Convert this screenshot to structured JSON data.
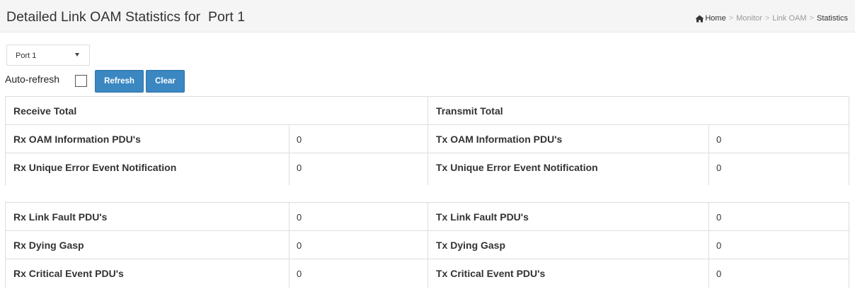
{
  "header": {
    "title": "Detailed Link OAM Statistics for  Port 1",
    "breadcrumb": [
      "Home",
      "Monitor",
      "Link OAM",
      "Statistics"
    ],
    "breadcrumb_separator": ">"
  },
  "controls": {
    "port_select": {
      "selected": "Port 1"
    },
    "auto_refresh_label": "Auto-refresh",
    "auto_refresh_checked": false,
    "refresh_label": "Refresh",
    "clear_label": "Clear"
  },
  "table": {
    "receive_header": "Receive Total",
    "transmit_header": "Transmit Total",
    "rows": [
      {
        "rx_label": "Rx OAM Information PDU's",
        "rx_value": "0",
        "tx_label": "Tx OAM Information PDU's",
        "tx_value": "0"
      },
      {
        "rx_label": "Rx Unique Error Event Notification",
        "rx_value": "0",
        "tx_label": "Tx Unique Error Event Notification",
        "tx_value": "0"
      },
      {
        "rx_label": "Rx Link Fault PDU's",
        "rx_value": "0",
        "tx_label": "Tx Link Fault PDU's",
        "tx_value": "0"
      },
      {
        "rx_label": "Rx Dying Gasp",
        "rx_value": "0",
        "tx_label": "Tx Dying Gasp",
        "tx_value": "0"
      },
      {
        "rx_label": "Rx Critical Event PDU's",
        "rx_value": "0",
        "tx_label": "Tx Critical Event PDU's",
        "tx_value": "0"
      }
    ]
  },
  "colors": {
    "button": "#3a87c2",
    "header_bg": "#f5f5f5",
    "border": "#dddddd"
  },
  "icons": {
    "home": "home-icon"
  }
}
